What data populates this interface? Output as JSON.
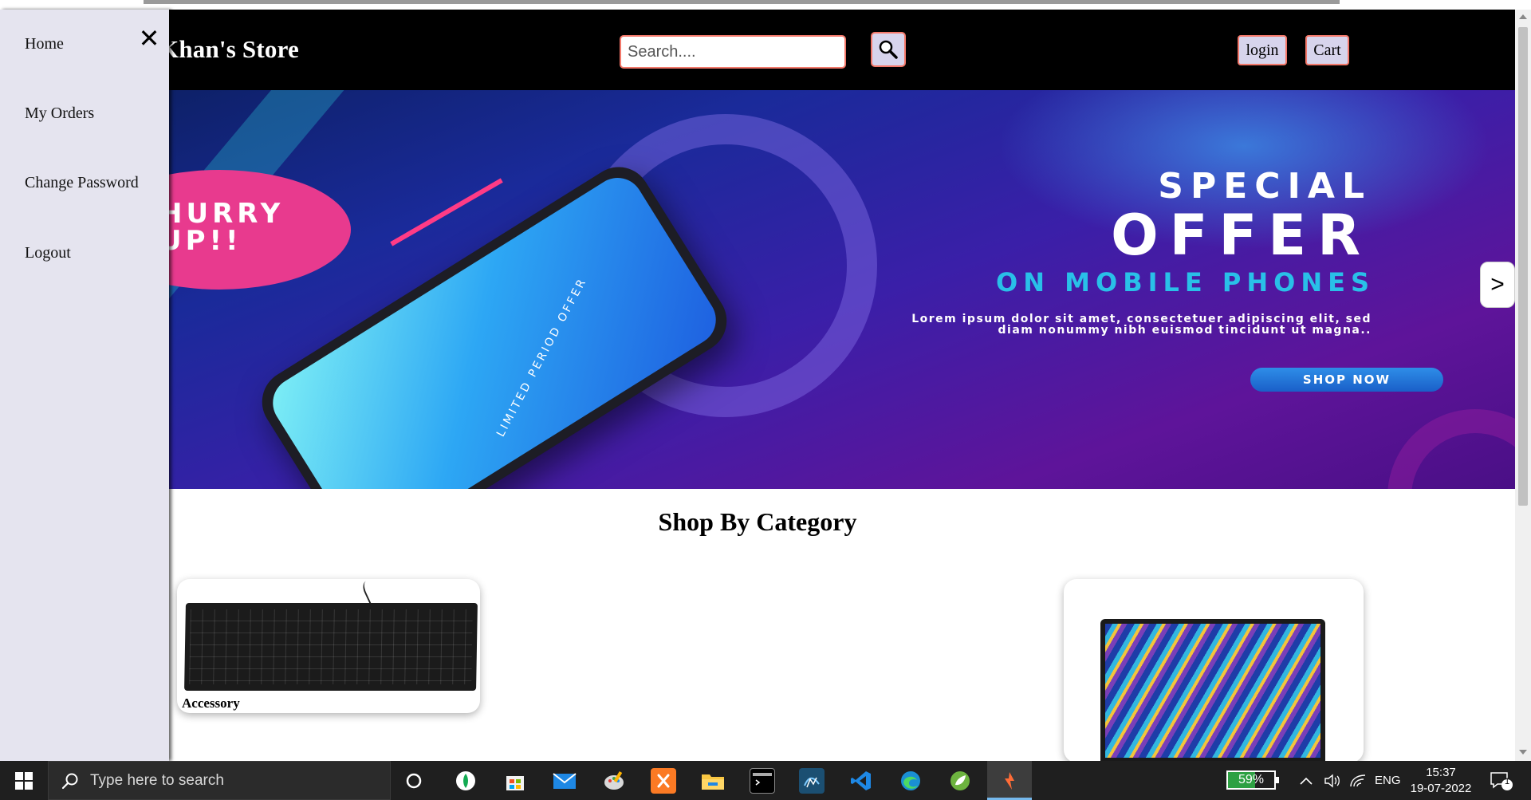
{
  "header": {
    "brand": "Khan's Store",
    "search_placeholder": "Search....",
    "login_label": "login",
    "cart_label": "Cart"
  },
  "sidebar": {
    "close_symbol": "✕",
    "items": [
      {
        "label": "Home"
      },
      {
        "label": "My Orders"
      },
      {
        "label": "Change Password"
      },
      {
        "label": "Logout"
      }
    ]
  },
  "banner": {
    "hurry": "HURRY\nUP!!",
    "limited": "LIMITED PERIOD OFFER",
    "special": "SPECIAL",
    "offer": "OFFER",
    "subtitle": "ON MOBILE PHONES",
    "lorem_line1": "Lorem ipsum dolor sit amet, consectetuer adipiscing elit, sed",
    "lorem_line2": "diam nonummy nibh euismod tincidunt ut magna..",
    "shop_now": "SHOP NOW",
    "next_label": ">"
  },
  "category_section": {
    "title": "Shop By Category",
    "cards": [
      {
        "label": "Accessory",
        "image": "keyboard"
      },
      {
        "label": "",
        "image": "laptop"
      }
    ]
  },
  "taskbar": {
    "search_placeholder": "Type here to search",
    "battery_percent": "59%",
    "battery_level": 0.59,
    "language": "ENG",
    "time": "15:37",
    "date": "19-07-2022",
    "notification_count": "1",
    "apps": [
      "cortana-icon",
      "mongodb-compass-icon",
      "microsoft-store-icon",
      "mail-icon",
      "paint-icon",
      "xampp-icon",
      "file-explorer-icon",
      "terminal-icon",
      "mysql-workbench-icon",
      "vscode-icon",
      "edge-icon",
      "spring-tool-suite-icon",
      "postman-icon"
    ],
    "colors": {
      "accent": "#76b9ed",
      "battery_fill": "#2ea043"
    }
  },
  "theme": {
    "navbar_bg": "#000000",
    "button_border": "#f3786a",
    "button_bg": "#d7d4ec",
    "sidenav_bg": "#e5e4ef"
  }
}
